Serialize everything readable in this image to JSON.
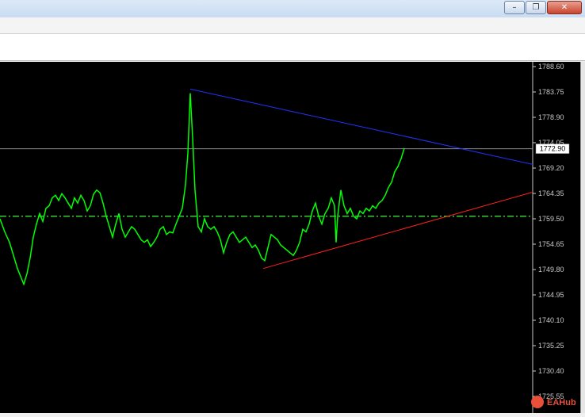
{
  "window": {
    "minimize_glyph": "–",
    "restore_glyph": "❐",
    "close_glyph": "✕"
  },
  "chart_data": {
    "type": "line",
    "price_labels": [
      "1788.60",
      "1783.75",
      "1778.90",
      "1774.05",
      "1769.20",
      "1764.35",
      "1759.50",
      "1754.65",
      "1749.80",
      "1744.95",
      "1740.10",
      "1735.25",
      "1730.40",
      "1725.55"
    ],
    "current_price": "1772.90",
    "ylim": [
      1725.55,
      1788.6
    ],
    "grid": false,
    "colors": {
      "background": "#000000",
      "price_line": "#00ff00",
      "axis_text": "#c8c8c8",
      "upper_trendline": "#2233ff",
      "lower_trendline": "#ff2020",
      "dashed_level": "#33cc33"
    },
    "dashed_level": 1760.0,
    "upper_trendline": {
      "from": [
        240,
        1784.3
      ],
      "to": [
        672,
        1769.9
      ]
    },
    "lower_trendline": {
      "from": [
        332,
        1750.0
      ],
      "to": [
        672,
        1764.6
      ]
    },
    "series": [
      {
        "x": [
          0,
          6,
          12,
          18,
          22,
          26,
          30,
          34,
          38,
          42,
          46,
          50,
          54,
          58,
          62,
          66,
          70,
          74,
          78,
          82,
          86,
          90,
          94,
          98,
          102,
          106,
          110,
          114,
          118,
          122,
          126,
          130,
          134,
          138,
          142,
          146,
          150,
          154,
          158,
          162,
          166,
          170,
          174,
          178,
          182,
          186,
          190,
          194,
          198,
          202,
          206,
          210,
          214,
          218,
          222,
          226,
          230,
          234,
          237,
          240,
          243,
          246,
          250,
          254,
          258,
          262,
          266,
          270,
          274,
          278,
          282,
          286,
          290,
          294,
          298,
          302,
          306,
          310,
          314,
          318,
          322,
          326,
          330,
          334,
          338,
          342,
          346,
          350,
          354,
          358,
          362,
          366,
          370,
          374,
          378,
          382,
          386,
          390,
          394,
          398,
          402,
          406,
          410,
          414,
          418,
          422,
          424,
          426,
          430,
          434,
          438,
          442,
          446,
          450,
          454,
          458,
          462,
          466,
          470,
          474,
          478,
          482,
          486,
          490,
          494,
          498,
          502,
          506,
          510
        ],
        "y": [
          1759.5,
          1757.0,
          1755.0,
          1752.0,
          1750.0,
          1748.5,
          1747.0,
          1749.0,
          1752.0,
          1756.0,
          1758.5,
          1760.5,
          1759.0,
          1761.5,
          1762.0,
          1763.5,
          1764.0,
          1763.0,
          1764.3,
          1763.5,
          1762.5,
          1761.5,
          1763.5,
          1762.5,
          1764.0,
          1763.0,
          1761.0,
          1762.0,
          1764.2,
          1765.0,
          1764.5,
          1762.5,
          1760.0,
          1758.0,
          1756.0,
          1758.5,
          1760.5,
          1757.5,
          1756.0,
          1757.0,
          1758.0,
          1757.5,
          1756.5,
          1755.5,
          1755.0,
          1755.5,
          1754.2,
          1755.0,
          1756.0,
          1757.5,
          1758.0,
          1756.5,
          1757.0,
          1756.8,
          1758.5,
          1760.0,
          1761.5,
          1766.0,
          1772.0,
          1783.5,
          1775.0,
          1765.0,
          1758.0,
          1757.0,
          1759.5,
          1758.0,
          1757.5,
          1758.0,
          1757.0,
          1755.5,
          1753.0,
          1755.0,
          1756.5,
          1757.0,
          1756.0,
          1755.0,
          1755.5,
          1756.0,
          1755.0,
          1754.0,
          1754.5,
          1753.5,
          1752.0,
          1751.5,
          1754.0,
          1756.5,
          1756.0,
          1755.5,
          1754.5,
          1754.0,
          1753.5,
          1753.0,
          1752.5,
          1753.5,
          1755.0,
          1757.5,
          1757.0,
          1758.5,
          1761.0,
          1762.5,
          1760.0,
          1758.5,
          1760.5,
          1761.5,
          1763.5,
          1762.0,
          1755.0,
          1760.0,
          1765.0,
          1762.0,
          1760.5,
          1761.5,
          1760.0,
          1759.5,
          1761.0,
          1760.5,
          1761.5,
          1761.0,
          1762.0,
          1761.5,
          1762.5,
          1763.0,
          1764.0,
          1765.5,
          1766.5,
          1768.5,
          1769.5,
          1771.0,
          1773.0
        ]
      }
    ]
  },
  "watermark": {
    "text": "EAHub",
    "icon": "eahub-logo-icon"
  }
}
